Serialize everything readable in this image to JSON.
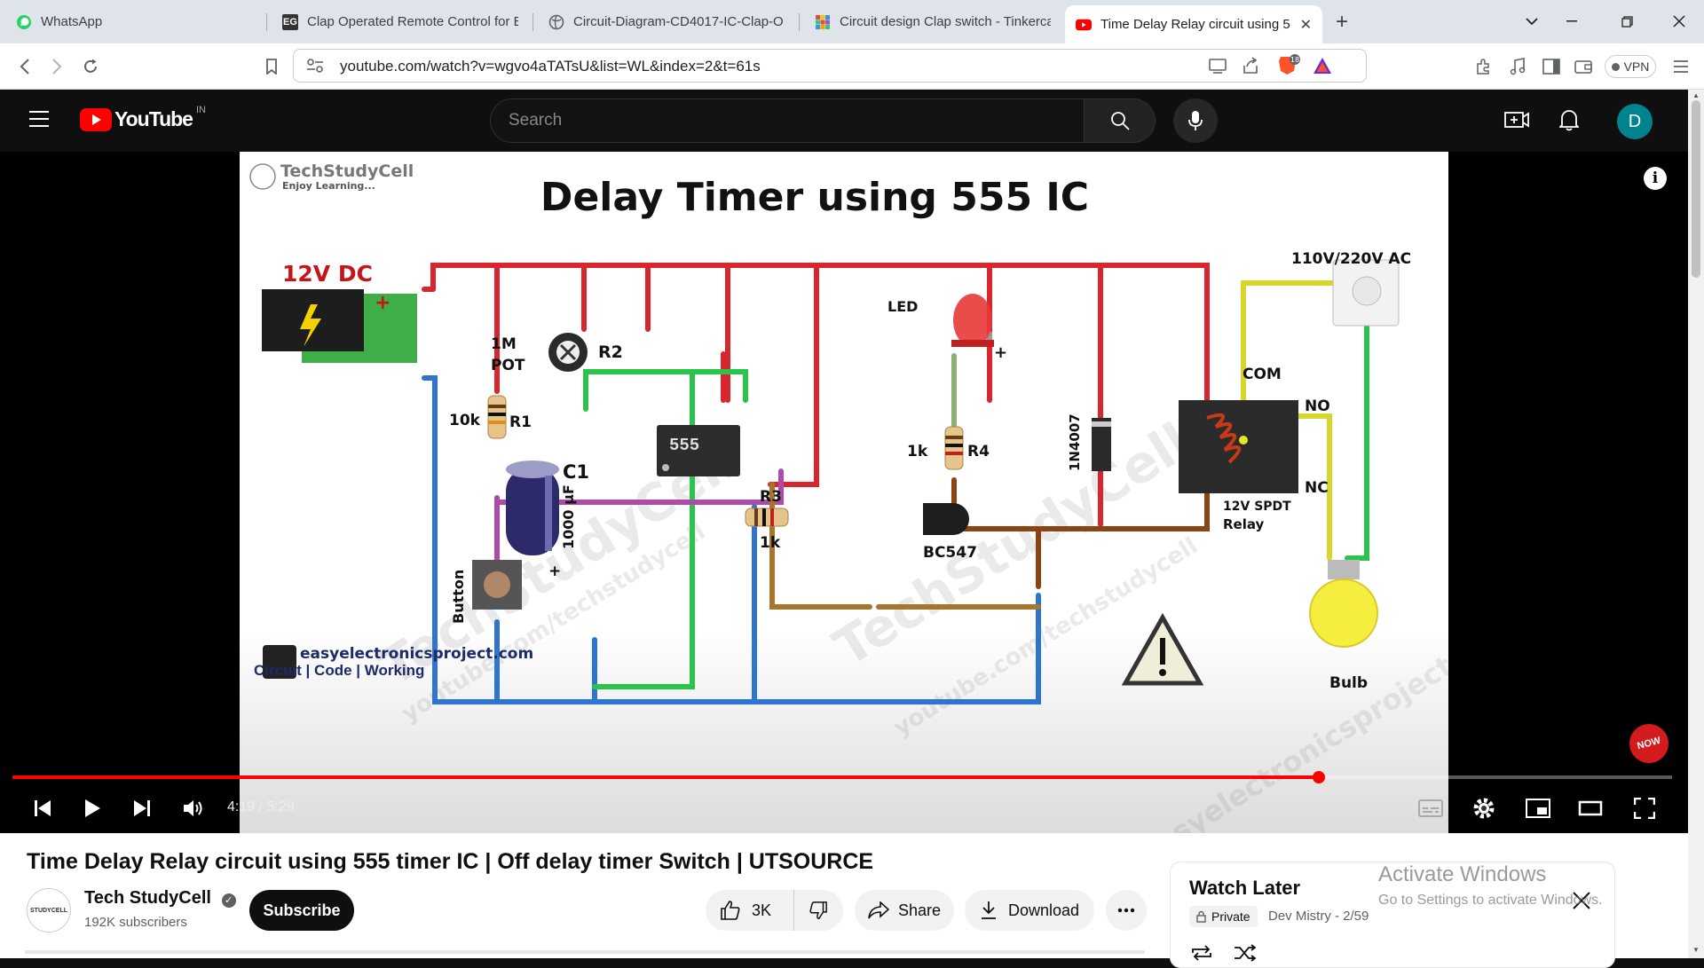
{
  "browser": {
    "tabs": [
      {
        "title": "WhatsApp",
        "favicon": "whatsapp-icon",
        "color": "#25d366"
      },
      {
        "title": "Clap Operated Remote Control for E",
        "favicon": "eg-icon",
        "color": "#333333"
      },
      {
        "title": "Circuit-Diagram-CD4017-IC-Clap-O",
        "favicon": "globe-icon",
        "color": "#5f6368"
      },
      {
        "title": "Circuit design Clap switch - Tinkerca",
        "favicon": "tinkercad-icon",
        "color": "#e74c3c"
      },
      {
        "title": "Time Delay Relay circuit using 5",
        "favicon": "youtube-icon",
        "color": "#ff0000"
      }
    ],
    "url": "youtube.com/watch?v=wgvo4aTATsU&list=WL&index=2&t=61s",
    "brave_badge": "18",
    "vpn_label": "VPN"
  },
  "youtube": {
    "logo_text": "YouTube",
    "region": "IN",
    "search_placeholder": "Search",
    "avatar_letter": "D"
  },
  "video": {
    "frame_title": "Delay Timer using 555 IC",
    "brand_name": "TechStudyCell",
    "brand_tagline": "Enjoy Learning...",
    "footer_site": "easyelectronicsproject.com",
    "footer_tagline": "Circuit | Code | Working",
    "watermark_1": "TechStudyCell",
    "watermark_2": "youtube.com/techstudycell",
    "watermark_3": "easyelectronicsproject.com",
    "labels": {
      "dc": "12V DC",
      "plus": "+",
      "pot_1": "1M",
      "pot_2": "POT",
      "r2": "R2",
      "r1_value": "10k",
      "r1": "R1",
      "ic": "555",
      "led": "LED",
      "r4_value": "1k",
      "r4": "R4",
      "diode": "1N4007",
      "ac": "110V/220V AC",
      "com": "COM",
      "no": "NO",
      "nc": "NC",
      "relay_1": "12V SPDT",
      "relay_2": "Relay",
      "button": "Button",
      "c1": "C1",
      "c1_value": "1000 µF",
      "r3": "R3",
      "r3_value": "1k",
      "transistor": "BC547",
      "bulb": "Bulb",
      "subscribe_badge": "NOW"
    },
    "current_time": "4:19",
    "duration": "5:29",
    "progress": 0.787
  },
  "below": {
    "title": "Time Delay Relay circuit using 555 timer IC | Off delay timer Switch | UTSOURCE",
    "channel": "Tech StudyCell",
    "subscribers": "192K subscribers",
    "subscribe": "Subscribe",
    "likes": "3K",
    "share": "Share",
    "download": "Download",
    "avatar_text": "STUDYCELL"
  },
  "watch_later": {
    "title": "Watch Later",
    "privacy": "Private",
    "owner_position": "Dev Mistry - 2/59"
  },
  "activation": {
    "line1": "Activate Windows",
    "line2": "Go to Settings to activate Windows."
  }
}
